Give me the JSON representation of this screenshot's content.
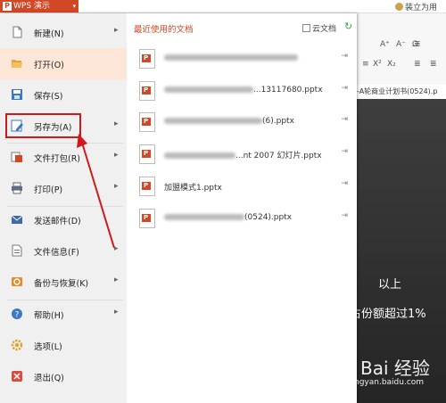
{
  "app": {
    "menu_button": "WPS 演示",
    "logo_letter": "P",
    "top_right_label": "装立为用",
    "ribbon_fonts": [
      "A⁺",
      "A⁻",
      "Ω"
    ],
    "ribbon_script": [
      "X²",
      "X₂"
    ],
    "doc_tab": "-A轮商业计划书(0524).p"
  },
  "menu": {
    "items": [
      {
        "label": "新建(N)",
        "icon": "new-document-icon",
        "arrow": true
      },
      {
        "label": "打开(O)",
        "icon": "open-folder-icon",
        "arrow": false,
        "active": true
      },
      {
        "label": "保存(S)",
        "icon": "save-icon",
        "arrow": false
      },
      {
        "label": "另存为(A)",
        "icon": "save-as-icon",
        "arrow": true
      },
      {
        "label": "文件打包(R)",
        "icon": "file-package-icon",
        "arrow": true
      },
      {
        "label": "打印(P)",
        "icon": "print-icon",
        "arrow": true
      },
      {
        "label": "发送邮件(D)",
        "icon": "email-icon",
        "arrow": false
      },
      {
        "label": "文件信息(F)",
        "icon": "file-info-icon",
        "arrow": true
      },
      {
        "label": "备份与恢复(K)",
        "icon": "backup-restore-icon",
        "arrow": true
      },
      {
        "label": "帮助(H)",
        "icon": "help-icon",
        "arrow": true
      },
      {
        "label": "选项(L)",
        "icon": "options-gear-icon",
        "arrow": false
      },
      {
        "label": "退出(Q)",
        "icon": "exit-icon",
        "arrow": false
      }
    ]
  },
  "recent": {
    "title": "最近使用的文档",
    "cloud_label": "云文档",
    "files": [
      {
        "visible": ""
      },
      {
        "visible": "...13117680.pptx"
      },
      {
        "visible": "(6).pptx"
      },
      {
        "visible": "...nt 2007 幻灯片.pptx"
      },
      {
        "visible": "加盟模式1.pptx"
      },
      {
        "visible": "(0524).pptx"
      }
    ]
  },
  "slide": {
    "line1": "以上",
    "line2": "占份额超过1%"
  },
  "watermark": {
    "main": "Bai 经验",
    "sub": "jingyan.baidu.com"
  },
  "colors": {
    "wps_orange": "#d24726",
    "highlight_red": "#d0191b",
    "active_bg": "#fde6d8"
  }
}
